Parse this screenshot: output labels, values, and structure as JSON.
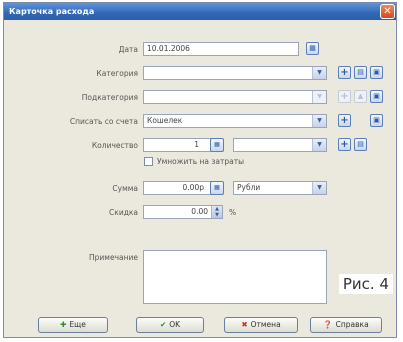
{
  "window": {
    "title": "Карточка расхода",
    "close_glyph": "✕"
  },
  "form": {
    "date": {
      "label": "Дата",
      "value": "10.01.2006",
      "icon": "calendar-icon"
    },
    "category": {
      "label": "Категория",
      "value": ""
    },
    "subcategory": {
      "label": "Подкатегория",
      "value": ""
    },
    "account": {
      "label": "Списать со счета",
      "value": "Кошелек"
    },
    "quantity": {
      "label": "Количество",
      "value": "1",
      "unit_value": ""
    },
    "multiply_checkbox": {
      "label": "Умножить на затраты",
      "checked": false
    },
    "sum": {
      "label": "Сумма",
      "value": "0.00р",
      "currency": "Рубли"
    },
    "discount": {
      "label": "Скидка",
      "value": "0.00",
      "unit": "%"
    },
    "note": {
      "label": "Примечание",
      "value": ""
    }
  },
  "buttons": {
    "more": {
      "label": "Еще",
      "icon": "plus-icon"
    },
    "ok": {
      "label": "OK",
      "icon": "check-icon"
    },
    "cancel": {
      "label": "Отмена",
      "icon": "x-icon"
    },
    "help": {
      "label": "Справка",
      "icon": "help-icon"
    }
  },
  "caption": "Рис. 4",
  "colors": {
    "titlebar": "#3167b6",
    "window_bg": "#ebe9dd",
    "accent": "#2f5aa0"
  }
}
